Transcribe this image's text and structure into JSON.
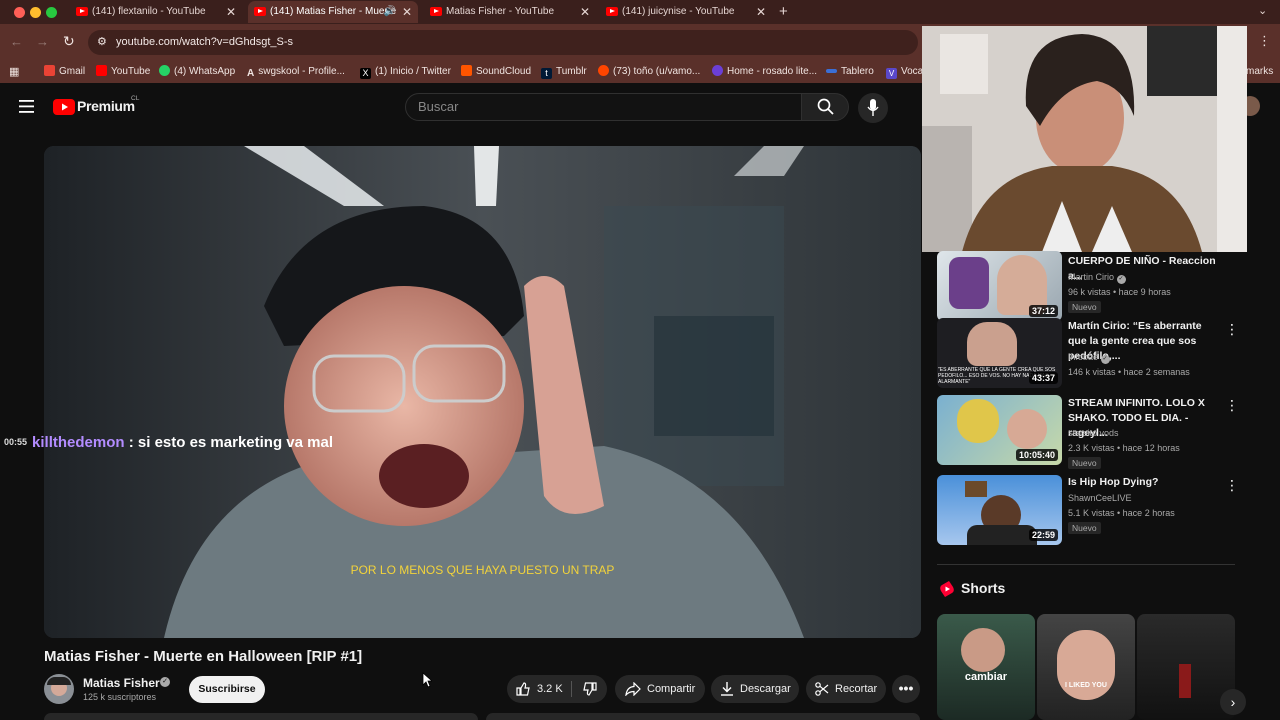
{
  "browser": {
    "tabs": [
      {
        "title": "(141) flextanilo - YouTube"
      },
      {
        "title": "(141) Matias Fisher - Muerte"
      },
      {
        "title": "Matias Fisher - YouTube"
      },
      {
        "title": "(141) juicynise - YouTube"
      }
    ],
    "url": "youtube.com/watch?v=dGhdsgt_S-s",
    "bookmarks": [
      {
        "label": "Gmail"
      },
      {
        "label": "YouTube"
      },
      {
        "label": "(4) WhatsApp"
      },
      {
        "label": "swgskool - Profile..."
      },
      {
        "label": "(1) Inicio / Twitter"
      },
      {
        "label": "SoundCloud"
      },
      {
        "label": "Tumblr"
      },
      {
        "label": "(73) toño (u/vamo..."
      },
      {
        "label": "Home - rosado lite..."
      },
      {
        "label": "Tablero"
      },
      {
        "label": "Vocal"
      }
    ],
    "bookmarks_overflow": "marks"
  },
  "youtube": {
    "logo_text": "Premium",
    "region": "CL",
    "search_placeholder": "Buscar"
  },
  "chat": {
    "time": "00:55",
    "user": "killthedemon",
    "separator": " : ",
    "message": "si esto es marketing va mal"
  },
  "video": {
    "subtitle": "POR LO MENOS QUE HAYA PUESTO UN TRAP",
    "title": "Matias Fisher - Muerte en Halloween [RIP #1]",
    "channel": "Matias Fisher",
    "subscribers": "125 k suscriptores",
    "subscribe_label": "Suscribirse",
    "likes": "3.2 K",
    "share_label": "Compartir",
    "download_label": "Descargar",
    "clip_label": "Recortar"
  },
  "recommendations": [
    {
      "title": "CUERPO DE NIÑO - Reaccion a...",
      "channel": "Martin Cirio",
      "verified": true,
      "meta": "96 k vistas • hace 9 horas",
      "badge": "Nuevo",
      "duration": "37:12"
    },
    {
      "title": "Martín Cirio: “Es aberrante que la gente crea que sos pedófilo,...",
      "channel": "Infobae",
      "verified": true,
      "meta": "146 k vistas • hace 2 semanas",
      "badge": "",
      "duration": "43:37",
      "thumb_caption": "\"ES ABERRANTE QUE LA GENTE CREA QUE SOS PEDOFILO... ESO DE VOS. NO HAY NADA MAS ALARMANTE\""
    },
    {
      "title": "STREAM INFINITO. LOLO X SHAKO. TODO EL DIA. - rageyl...",
      "channel": "starsito vods",
      "verified": false,
      "meta": "2.3 K vistas • hace 12 horas",
      "badge": "Nuevo",
      "duration": "10:05:40"
    },
    {
      "title": "Is Hip Hop Dying?",
      "channel": "ShawnCeeLIVE",
      "verified": false,
      "meta": "5.1 K vistas • hace 2 horas",
      "badge": "Nuevo",
      "duration": "22:59"
    }
  ],
  "shorts": {
    "heading": "Shorts",
    "items": [
      {
        "caption": "cambiar"
      },
      {
        "caption": "I LIKED YOU"
      },
      {
        "caption": ""
      }
    ]
  },
  "colors": {
    "browser_tab_bg": "#3a1f1c",
    "browser_toolbar_bg": "#5a302a",
    "yt_red": "#ff0000",
    "chat_user": "#b38cff",
    "subtitle_yellow": "#f2d33b"
  }
}
